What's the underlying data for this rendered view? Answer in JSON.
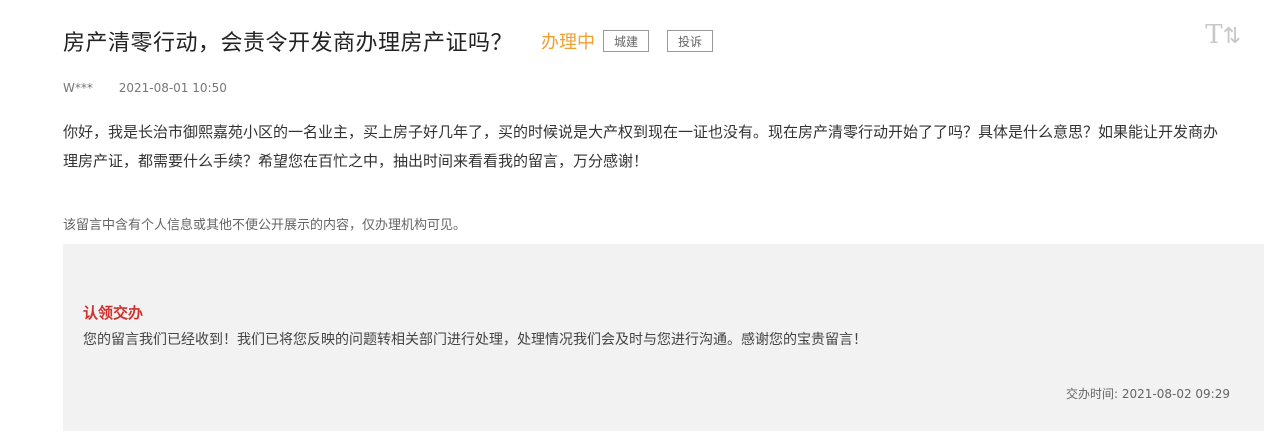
{
  "post": {
    "title": "房产清零行动，会责令开发商办理房产证吗？",
    "status": "办理中",
    "tags": [
      "城建",
      "投诉"
    ],
    "author": "W***",
    "datetime": "2021-08-01 10:50",
    "content": "你好，我是长治市御熙嘉苑小区的一名业主，买上房子好几年了，买的时候说是大产权到现在一证也没有。现在房产清零行动开始了了吗？具体是什么意思？如果能让开发商办理房产证，都需要什么手续？希望您在百忙之中，抽出时间来看看我的留言，万分感谢！",
    "privacy_notice": "该留言中含有个人信息或其他不便公开展示的内容，仅办理机构可见。"
  },
  "font_toggle": {
    "glyph": "T",
    "bar": "⇅",
    "icon": "font-size-icon"
  },
  "reply": {
    "title": "认领交办",
    "text": "您的留言我们已经收到！我们已将您反映的问题转相关部门进行处理，处理情况我们会及时与您进行沟通。感谢您的宝贵留言！",
    "time_label": "交办时间:",
    "time": "2021-08-02 09:29"
  },
  "colors": {
    "status": "#f0a030",
    "reply_title": "#d0312d",
    "reply_bg": "#f2f2f2"
  }
}
